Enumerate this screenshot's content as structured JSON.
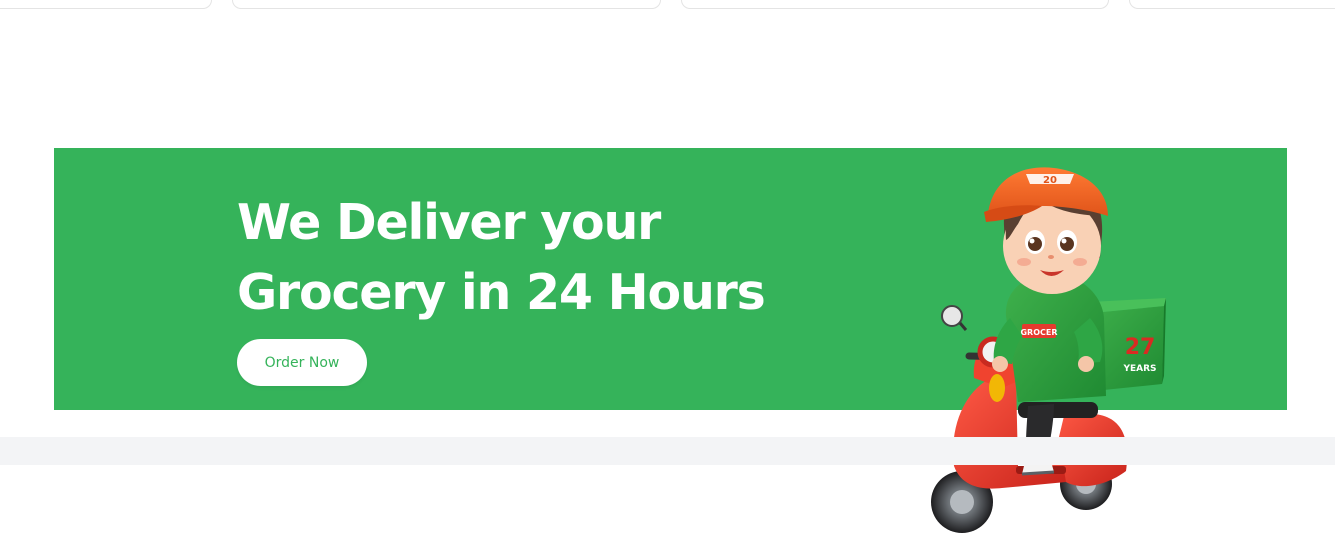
{
  "banner": {
    "headline_line1": "We Deliver your",
    "headline_line2": "Grocery in 24 Hours",
    "cta_label": "Order Now",
    "background_color": "#35b35a"
  },
  "illustration": {
    "cap_badge": "20",
    "hoodie_text": "GROCER",
    "box_number": "27",
    "box_label": "YEARS",
    "cap_color": "#f0651f",
    "scooter_color": "#e53a2e",
    "hoodie_color": "#2a9b3b"
  }
}
